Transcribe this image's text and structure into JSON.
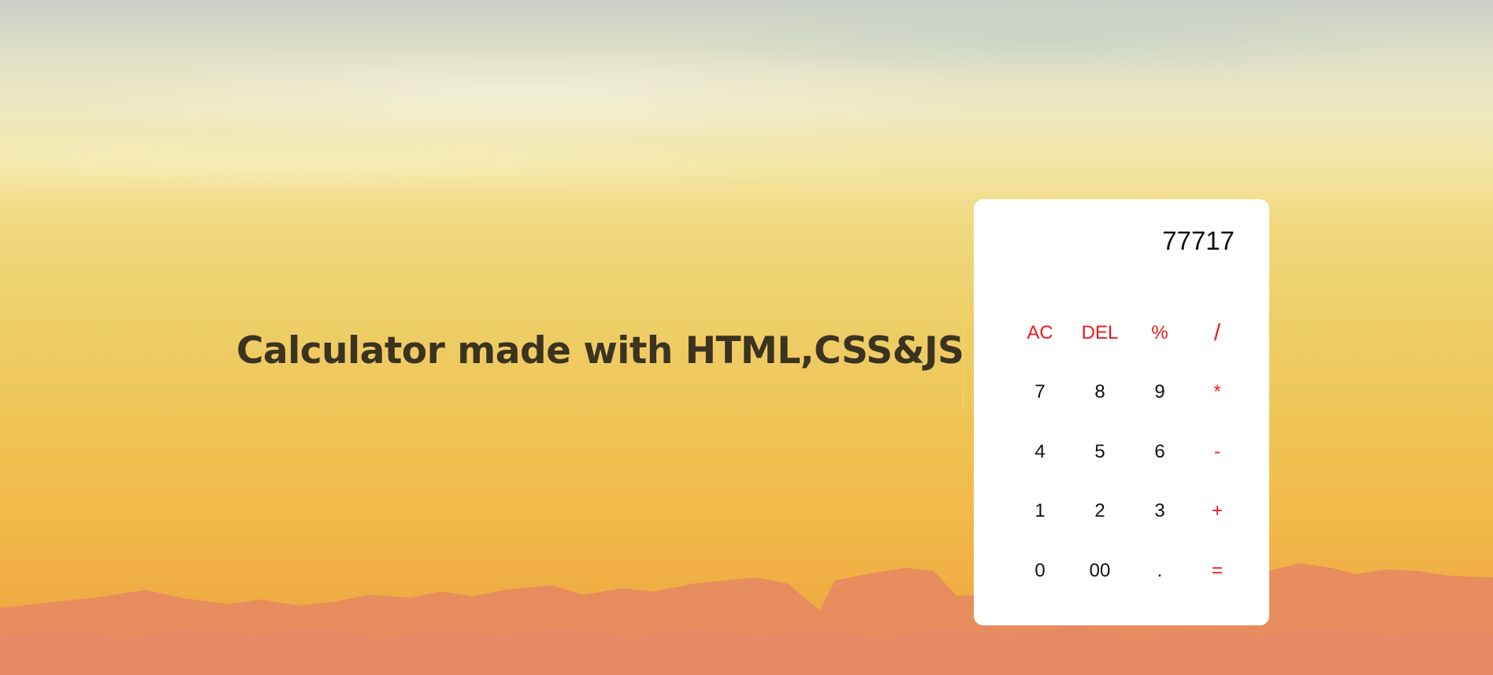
{
  "headline": "Calculator made with HTML,CSS&JS",
  "calculator": {
    "display": "77717",
    "keys": [
      {
        "label": "AC",
        "type": "op",
        "name": "all-clear-key"
      },
      {
        "label": "DEL",
        "type": "op",
        "name": "delete-key"
      },
      {
        "label": "%",
        "type": "op",
        "name": "percent-key"
      },
      {
        "label": "/",
        "type": "op",
        "name": "divide-key"
      },
      {
        "label": "7",
        "type": "num",
        "name": "digit-7-key"
      },
      {
        "label": "8",
        "type": "num",
        "name": "digit-8-key"
      },
      {
        "label": "9",
        "type": "num",
        "name": "digit-9-key"
      },
      {
        "label": "*",
        "type": "op",
        "name": "multiply-key"
      },
      {
        "label": "4",
        "type": "num",
        "name": "digit-4-key"
      },
      {
        "label": "5",
        "type": "num",
        "name": "digit-5-key"
      },
      {
        "label": "6",
        "type": "num",
        "name": "digit-6-key"
      },
      {
        "label": "-",
        "type": "op",
        "name": "subtract-key"
      },
      {
        "label": "1",
        "type": "num",
        "name": "digit-1-key"
      },
      {
        "label": "2",
        "type": "num",
        "name": "digit-2-key"
      },
      {
        "label": "3",
        "type": "num",
        "name": "digit-3-key"
      },
      {
        "label": "+",
        "type": "op",
        "name": "add-key"
      },
      {
        "label": "0",
        "type": "num",
        "name": "digit-0-key"
      },
      {
        "label": "00",
        "type": "num",
        "name": "double-zero-key"
      },
      {
        "label": ".",
        "type": "num",
        "name": "decimal-key"
      },
      {
        "label": "=",
        "type": "op",
        "name": "equals-key"
      }
    ]
  },
  "colors": {
    "operator": "#ee1a1a",
    "digit": "#111111",
    "headline": "#3b3320",
    "card": "#ffffff"
  }
}
